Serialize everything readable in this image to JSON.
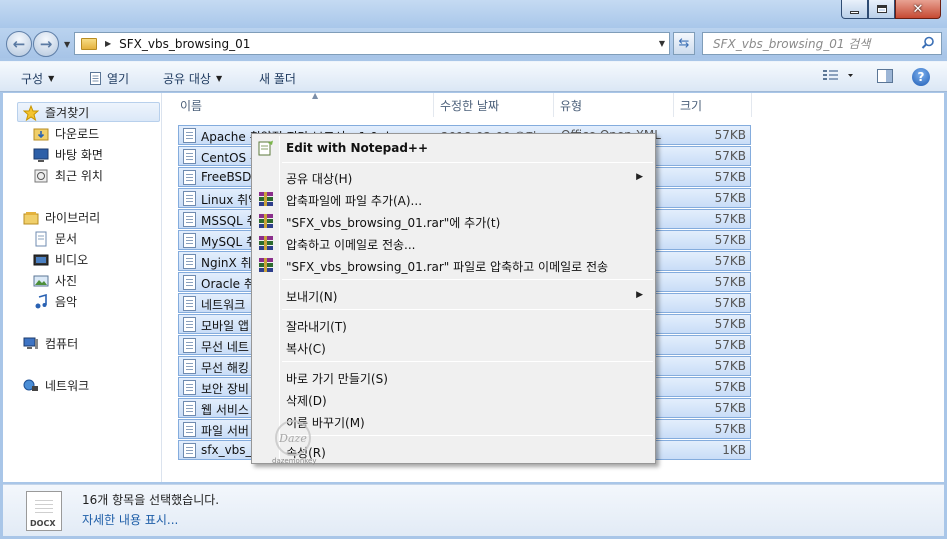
{
  "address": {
    "crumb": "SFX_vbs_browsing_01",
    "search_placeholder": "SFX_vbs_browsing_01 검색"
  },
  "toolbar": {
    "organize": "구성",
    "open": "열기",
    "share": "공유 대상",
    "new_folder": "새 폴더"
  },
  "sidebar": {
    "favorites": "즐겨찾기",
    "downloads": "다운로드",
    "desktop": "바탕 화면",
    "recent": "최근 위치",
    "libraries": "라이브러리",
    "documents": "문서",
    "videos": "비디오",
    "pictures": "사진",
    "music": "음악",
    "computer": "컴퓨터",
    "network": "네트워크"
  },
  "columns": {
    "name": "이름",
    "modified": "수정한 날짜",
    "type": "유형",
    "size": "크기"
  },
  "files": [
    {
      "name": "Apache 취약점 진단 보고서_v1.0.docx",
      "date": "2018-02-09 오전",
      "type": "Office Open XML",
      "size": "57KB"
    },
    {
      "name": "CentOS 취",
      "size": "57KB"
    },
    {
      "name": "FreeBSD",
      "size": "57KB"
    },
    {
      "name": "Linux 취약",
      "size": "57KB"
    },
    {
      "name": "MSSQL 취",
      "size": "57KB"
    },
    {
      "name": "MySQL 취",
      "size": "57KB"
    },
    {
      "name": "NginX 취",
      "size": "57KB"
    },
    {
      "name": "Oracle 취",
      "size": "57KB"
    },
    {
      "name": "네트워크",
      "size": "57KB"
    },
    {
      "name": "모바일 앱",
      "size": "57KB"
    },
    {
      "name": "무선 네트",
      "size": "57KB"
    },
    {
      "name": "무선 해킹",
      "size": "57KB"
    },
    {
      "name": "보안 장비",
      "size": "57KB"
    },
    {
      "name": "웹 서비스",
      "size": "57KB"
    },
    {
      "name": "파일 서버",
      "size": "57KB"
    },
    {
      "name": "sfx_vbs_b",
      "size": "1KB"
    }
  ],
  "context_menu": {
    "edit_notepad": "Edit with Notepad++",
    "share": "공유 대상(H)",
    "add_archive": "압축파일에 파일 추가(A)...",
    "add_to_rar": "\"SFX_vbs_browsing_01.rar\"에 추가(t)",
    "compress_email": "압축하고 이메일로 전송...",
    "compress_rar_email": "\"SFX_vbs_browsing_01.rar\" 파일로 압축하고 이메일로 전송",
    "send_to": "보내기(N)",
    "cut": "잘라내기(T)",
    "copy": "복사(C)",
    "shortcut": "바로 가기 만들기(S)",
    "delete": "삭제(D)",
    "rename": "이름 바꾸기(M)",
    "properties": "속성(R)"
  },
  "watermark": {
    "text": "Daze",
    "sub": "dazemonkey"
  },
  "details": {
    "thumb_label": "DOCX",
    "count": "16개 항목을 선택했습니다.",
    "more": "자세한 내용 표시..."
  }
}
